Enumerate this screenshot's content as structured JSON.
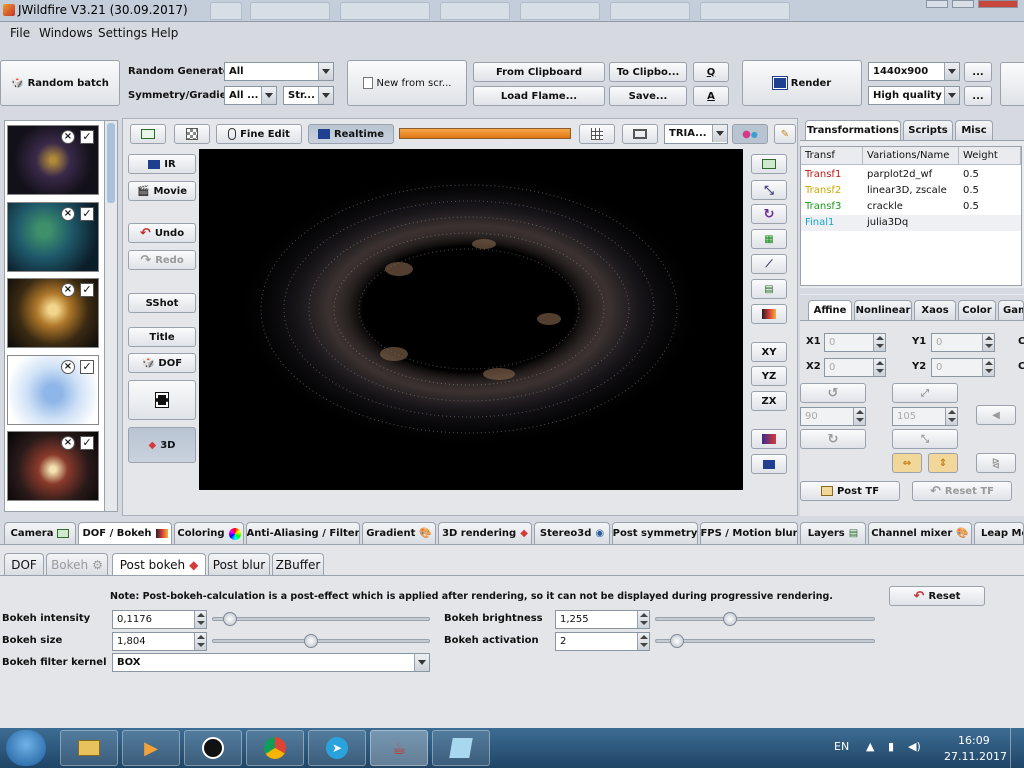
{
  "window": {
    "title": "JWildfire V3.21 (30.09.2017)"
  },
  "menu": [
    "File",
    "Windows",
    "Settings",
    "Help"
  ],
  "toolbar": {
    "random_batch": "Random batch",
    "random_generator_label": "Random Generator",
    "random_generator_value": "All",
    "symmetry_label": "Symmetry/Gradient",
    "symmetry_value": "All ...",
    "gradient_value": "Str...",
    "new_from_script": "New from scr...",
    "from_clipboard": "From Clipboard",
    "to_clipboard": "To Clipbo...",
    "q": "Q",
    "load_flame": "Load Flame...",
    "save": "Save...",
    "a": "A",
    "render": "Render",
    "resolution": "1440x900",
    "quality": "High quality",
    "more": "..."
  },
  "canvas_toolbar": {
    "fine_edit": "Fine Edit",
    "realtime": "Realtime",
    "tria": "TRIA..."
  },
  "left_tools": {
    "ir": "IR",
    "movie": "Movie",
    "undo": "Undo",
    "redo": "Redo",
    "sshot": "SShot",
    "title": "Title",
    "dof": "DOF",
    "threed": "3D"
  },
  "right_tools": {
    "xy": "XY",
    "yz": "YZ",
    "zx": "ZX"
  },
  "right_tabs": [
    "Transformations",
    "Scripts",
    "Misc"
  ],
  "transform_table": {
    "headers": [
      "Transf",
      "Variations/Name",
      "Weight"
    ],
    "rows": [
      {
        "transf": "Transf1",
        "name": "parplot2d_wf",
        "weight": "0.5",
        "color": "#c01818"
      },
      {
        "transf": "Transf2",
        "name": "linear3D, zscale",
        "weight": "0.5",
        "color": "#c8a800"
      },
      {
        "transf": "Transf3",
        "name": "crackle",
        "weight": "0.5",
        "color": "#1a9a1a"
      },
      {
        "transf": "Final1",
        "name": "julia3Dq",
        "weight": "",
        "color": "#18a8c8"
      }
    ]
  },
  "affine_tabs": [
    "Affine",
    "Nonlinear",
    "Xaos",
    "Color",
    "Gam"
  ],
  "affine": {
    "x1": "X1",
    "y1": "Y1",
    "x2": "X2",
    "y2": "Y2",
    "x1_val": "0",
    "y1_val": "0",
    "x2_val": "0",
    "y2_val": "0",
    "rotate_val": "90",
    "scale_val": "105",
    "post_tf": "Post TF",
    "reset_tf": "Reset TF"
  },
  "bottom_tabs": [
    "Camera",
    "DOF / Bokeh",
    "Coloring",
    "Anti-Aliasing / Filter",
    "Gradient",
    "3D rendering",
    "Stereo3d",
    "Post symmetry",
    "FPS / Motion blur",
    "Layers",
    "Channel mixer",
    "Leap Mo"
  ],
  "sub_tabs": [
    "DOF",
    "Bokeh",
    "Post bokeh",
    "Post blur",
    "ZBuffer"
  ],
  "bokeh": {
    "note": "Note: Post-bokeh-calculation is a post-effect which is applied after rendering, so it can not be displayed during progressive rendering.",
    "reset": "Reset",
    "intensity_label": "Bokeh intensity",
    "intensity_value": "0,1176",
    "size_label": "Bokeh size",
    "size_value": "1,804",
    "filter_label": "Bokeh filter kernel",
    "filter_value": "BOX",
    "brightness_label": "Bokeh brightness",
    "brightness_value": "1,255",
    "activation_label": "Bokeh activation",
    "activation_value": "2",
    "intensity_slider": 0.05,
    "size_slider": 0.45,
    "brightness_slider": 0.33,
    "activation_slider": 0.07
  },
  "taskbar": {
    "lang": "EN",
    "time": "16:09",
    "date": "27.11.2017"
  }
}
